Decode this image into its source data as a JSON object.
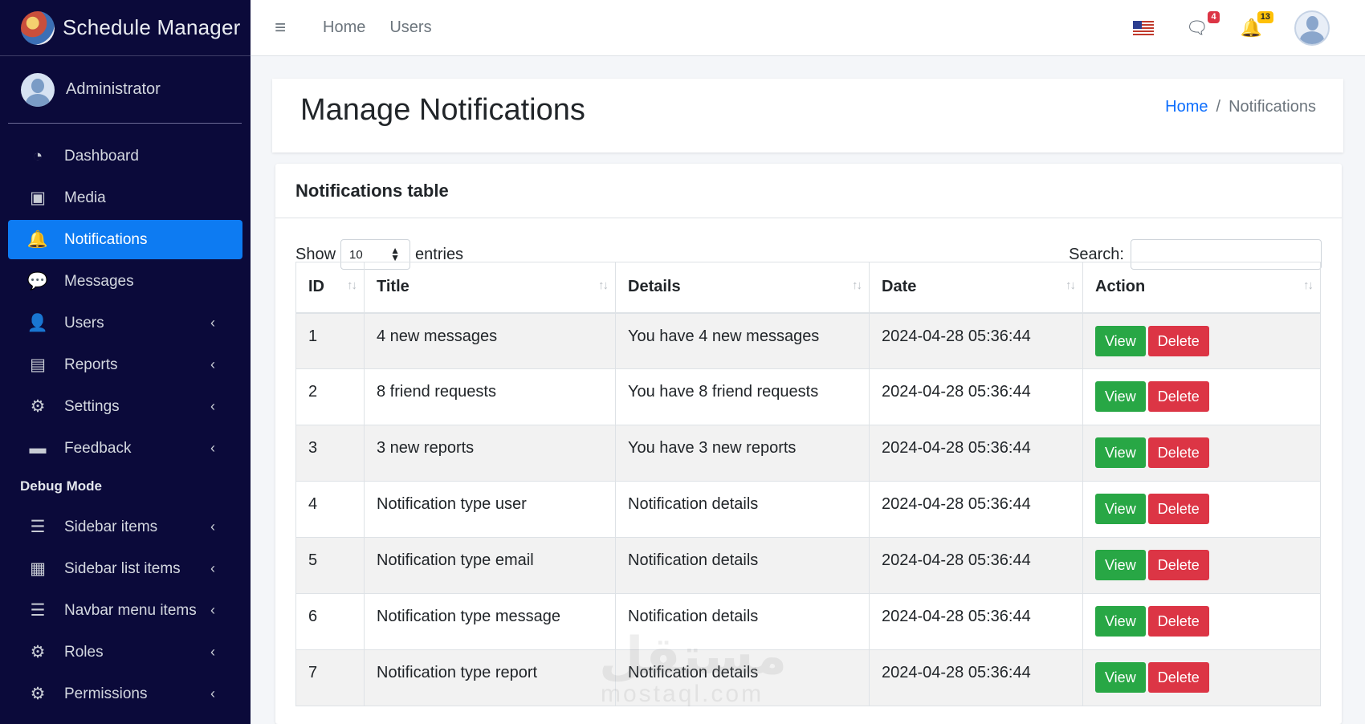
{
  "brand": {
    "title": "Schedule Manager"
  },
  "user": {
    "name": "Administrator"
  },
  "sidebar": {
    "items": [
      {
        "label": "Dashboard",
        "icon": "tachometer-icon",
        "glyph": "◔",
        "active": false,
        "arrow": false
      },
      {
        "label": "Media",
        "icon": "images-icon",
        "glyph": "▣",
        "active": false,
        "arrow": false
      },
      {
        "label": "Notifications",
        "icon": "bell-icon",
        "glyph": "🔔",
        "active": true,
        "arrow": false
      },
      {
        "label": "Messages",
        "icon": "comments-icon",
        "glyph": "💬",
        "active": false,
        "arrow": false
      },
      {
        "label": "Users",
        "icon": "user-icon",
        "glyph": "👤",
        "active": false,
        "arrow": true
      },
      {
        "label": "Reports",
        "icon": "file-icon",
        "glyph": "▤",
        "active": false,
        "arrow": true
      },
      {
        "label": "Settings",
        "icon": "gear-icon",
        "glyph": "⚙",
        "active": false,
        "arrow": true
      },
      {
        "label": "Feedback",
        "icon": "comment-icon",
        "glyph": "▬",
        "active": false,
        "arrow": true
      }
    ],
    "debug_header": "Debug Mode",
    "debug_items": [
      {
        "label": "Sidebar items",
        "icon": "list-icon",
        "glyph": "☰",
        "arrow": true
      },
      {
        "label": "Sidebar list items",
        "icon": "list-alt-icon",
        "glyph": "▦",
        "arrow": true
      },
      {
        "label": "Navbar menu items",
        "icon": "list-icon",
        "glyph": "☰",
        "arrow": true
      },
      {
        "label": "Roles",
        "icon": "gear-icon",
        "glyph": "⚙",
        "arrow": true
      },
      {
        "label": "Permissions",
        "icon": "gear-icon",
        "glyph": "⚙",
        "arrow": true
      }
    ],
    "arrow_glyph": "‹"
  },
  "topbar": {
    "menu_glyph": "≡",
    "links": [
      "Home",
      "Users"
    ],
    "messages_badge": "4",
    "notifications_badge": "13",
    "messages_glyph": "🗨",
    "bell_glyph": "🔔"
  },
  "page": {
    "title": "Manage Notifications",
    "breadcrumb_home": "Home",
    "breadcrumb_sep": "/",
    "breadcrumb_current": "Notifications"
  },
  "card": {
    "title": "Notifications table",
    "show_label": "Show",
    "entries_value": "10",
    "entries_label": "entries",
    "search_label": "Search:",
    "search_value": ""
  },
  "table": {
    "columns": [
      "ID",
      "Title",
      "Details",
      "Date",
      "Action"
    ],
    "sort_glyph": "↑↓",
    "view_label": "View",
    "delete_label": "Delete",
    "rows": [
      {
        "id": "1",
        "title": "4 new messages",
        "details": "You have 4 new messages",
        "date": "2024-04-28 05:36:44"
      },
      {
        "id": "2",
        "title": "8 friend requests",
        "details": "You have 8 friend requests",
        "date": "2024-04-28 05:36:44"
      },
      {
        "id": "3",
        "title": "3 new reports",
        "details": "You have 3 new reports",
        "date": "2024-04-28 05:36:44"
      },
      {
        "id": "4",
        "title": "Notification type user",
        "details": "Notification details",
        "date": "2024-04-28 05:36:44"
      },
      {
        "id": "5",
        "title": "Notification type email",
        "details": "Notification details",
        "date": "2024-04-28 05:36:44"
      },
      {
        "id": "6",
        "title": "Notification type message",
        "details": "Notification details",
        "date": "2024-04-28 05:36:44"
      },
      {
        "id": "7",
        "title": "Notification type report",
        "details": "Notification details",
        "date": "2024-04-28 05:36:44"
      }
    ]
  },
  "watermark": {
    "arabic": "مستقل",
    "latin": "mostaql.com"
  }
}
